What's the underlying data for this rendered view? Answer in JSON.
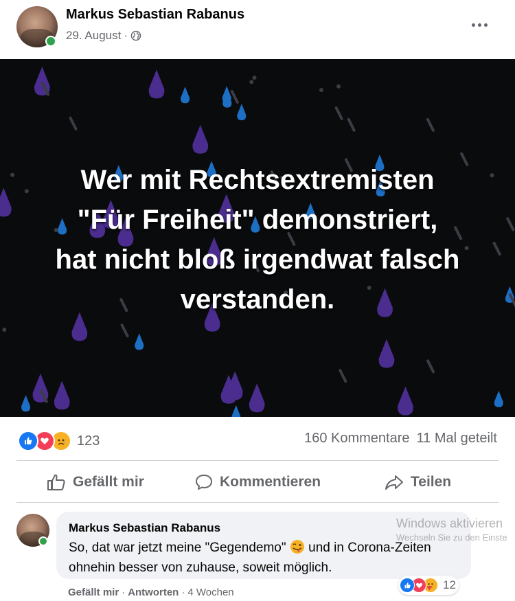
{
  "post": {
    "author": "Markus Sebastian Rabanus",
    "date": "29. August",
    "separator": "·",
    "privacy_icon": "globe-icon",
    "more_icon": "more-options-icon"
  },
  "image": {
    "lines": [
      "Wer mit Rechtsextremisten",
      "\"Für Freiheit\" demonstriert,",
      "hat nicht bloß irgendwat falsch",
      "verstanden."
    ],
    "background_color": "#0a0b0d",
    "drop_colors": [
      "#4b2d8f",
      "#1d6fc4",
      "#3b3d44"
    ]
  },
  "stats": {
    "reaction_icons": [
      "like-icon",
      "love-icon",
      "sad-icon"
    ],
    "reaction_count": "123",
    "comments": "160 Kommentare",
    "shares": "11 Mal geteilt"
  },
  "actions": {
    "like": "Gefällt mir",
    "comment": "Kommentieren",
    "share": "Teilen"
  },
  "comment": {
    "author": "Markus Sebastian Rabanus",
    "text_part1": "So, dat war jetzt meine \"Gegendemo\"",
    "text_part2": "und in Corona-Zeiten ohnehin besser von zuhause, soweit möglich.",
    "emoji": "winking-tongue-emoji",
    "reaction_count": "12",
    "reaction_icons": [
      "like-icon",
      "love-icon",
      "care-icon"
    ],
    "footer_like": "Gefällt mir",
    "footer_dot": "·",
    "footer_reply": "Antworten",
    "footer_time": "4 Wochen"
  },
  "watermark": {
    "title": "Windows aktivieren",
    "subtitle": "Wechseln Sie zu den Einste"
  },
  "colors": {
    "facebook_blue": "#1877f2",
    "secondary_text": "#65676b",
    "online_green": "#31a24c",
    "comment_bg": "#f0f2f5"
  }
}
